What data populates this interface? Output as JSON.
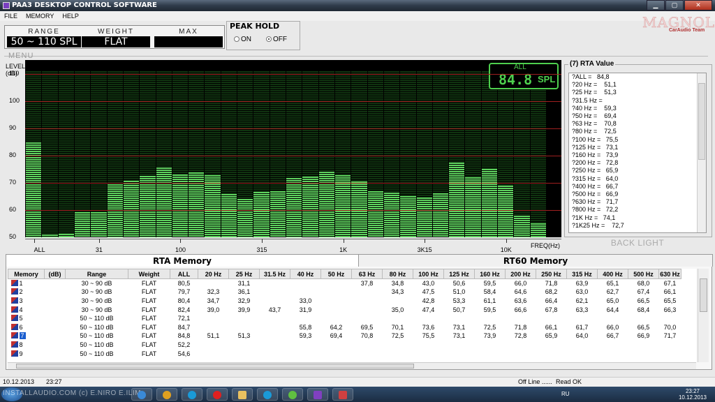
{
  "window": {
    "title": "PAA3 DESKTOP CONTROL SOFTWARE"
  },
  "menu": [
    "FILE",
    "MEMORY",
    "HELP"
  ],
  "logo": {
    "brand": "MAGNOLIA",
    "team": "CarAudio Team"
  },
  "display": {
    "range_label": "RANGE",
    "range_value": "50 ~ 110 SPL",
    "weight_label": "WEIGHT",
    "weight_value": "FLAT",
    "max_label": "MAX",
    "max_value": ""
  },
  "peak_hold": {
    "title": "PEAK HOLD",
    "on": "ON",
    "off": "OFF",
    "selected": "OFF"
  },
  "menu_section_label": "MENU",
  "graph": {
    "level_label": "LEVEL\n(dB)",
    "freq_label": "FREQ(Hz)",
    "all_label": "ALL",
    "spl_value": "84.8",
    "spl_unit": "SPL",
    "colors": {
      "bar": "#5fd45f",
      "bg": "#000000",
      "gridline": "#a02020"
    }
  },
  "chart_data": {
    "type": "bar",
    "ylabel": "LEVEL (dB)",
    "xlabel": "FREQ(Hz)",
    "ylim": [
      50,
      115
    ],
    "y_ticks": [
      50,
      60,
      70,
      80,
      90,
      100,
      110
    ],
    "x_tick_labels": [
      "ALL",
      "31",
      "100",
      "315",
      "1K",
      "3K15",
      "10K"
    ],
    "x_tick_band_index": [
      0,
      4,
      9,
      14,
      19,
      24,
      29
    ],
    "bands": [
      "ALL",
      "20",
      "25",
      "31.5",
      "40",
      "50",
      "63",
      "80",
      "100",
      "125",
      "160",
      "200",
      "250",
      "315",
      "400",
      "500",
      "630",
      "800",
      "1K",
      "1K25",
      "1K6",
      "2K",
      "2K5",
      "3K15",
      "4K",
      "5K",
      "6K3",
      "8K",
      "10K",
      "12K5",
      "16K",
      "20K"
    ],
    "values": [
      84.8,
      51.1,
      51.3,
      59.3,
      59.3,
      69.4,
      70.8,
      72.5,
      75.5,
      73.1,
      73.9,
      72.8,
      65.9,
      64.0,
      66.7,
      66.9,
      71.7,
      72.2,
      74.1,
      72.7,
      70.5,
      67.0,
      66.5,
      65.0,
      64.5,
      66.0,
      77.5,
      72.0,
      75.0,
      69.0,
      58.0,
      55.0
    ]
  },
  "rta_panel": {
    "title": "(7) RTA Value",
    "rows": [
      "?ALL =   84,8",
      "?20 Hz =    51,1",
      "?25 Hz =    51,3",
      "?31.5 Hz =",
      "?40 Hz =    59,3",
      "?50 Hz =    69,4",
      "?63 Hz =    70,8",
      "?80 Hz =    72,5",
      "?100 Hz =   75,5",
      "?125 Hz =   73,1",
      "?160 Hz =   73,9",
      "?200 Hz =   72,8",
      "?250 Hz =   65,9",
      "?315 Hz =   64,0",
      "?400 Hz =   66,7",
      "?500 Hz =   66,9",
      "?630 Hz =   71,7",
      "?800 Hz =   72,2",
      "?1K Hz =   74,1",
      "?1K25 Hz =    72,7"
    ],
    "backlight": "BACK LIGHT"
  },
  "tabs": {
    "rta": "RTA Memory",
    "rt60": "RT60 Memory"
  },
  "table": {
    "headers": [
      "Memory",
      "(dB)",
      "Range",
      "Weight",
      "ALL",
      "20 Hz",
      "25 Hz",
      "31.5 Hz",
      "40 Hz",
      "50 Hz",
      "63 Hz",
      "80 Hz",
      "100 Hz",
      "125 Hz",
      "160 Hz",
      "200 Hz",
      "250 Hz",
      "315 Hz",
      "400 Hz",
      "500 Hz",
      "630 Hz"
    ],
    "rows": [
      [
        "1",
        "",
        "30 ~ 90 dB",
        "FLAT",
        "80,5",
        "",
        "31,1",
        "",
        "",
        "",
        "37,8",
        "34,8",
        "43,0",
        "50,6",
        "59,5",
        "66,0",
        "71,8",
        "63,9",
        "65,1",
        "68,0",
        "67,1"
      ],
      [
        "2",
        "",
        "30 ~ 90 dB",
        "FLAT",
        "79,7",
        "32,3",
        "36,1",
        "",
        "",
        "",
        "",
        "34,3",
        "47,5",
        "51,0",
        "58,4",
        "64,6",
        "68,2",
        "63,0",
        "62,7",
        "67,4",
        "66,1"
      ],
      [
        "3",
        "",
        "30 ~ 90 dB",
        "FLAT",
        "80,4",
        "34,7",
        "32,9",
        "",
        "33,0",
        "",
        "",
        "",
        "42,8",
        "53,3",
        "61,1",
        "63,6",
        "66,4",
        "62,1",
        "65,0",
        "66,5",
        "65,5"
      ],
      [
        "4",
        "",
        "30 ~ 90 dB",
        "FLAT",
        "82,4",
        "39,0",
        "39,9",
        "43,7",
        "31,9",
        "",
        "",
        "35,0",
        "47,4",
        "50,7",
        "59,5",
        "66,6",
        "67,8",
        "63,3",
        "64,4",
        "68,4",
        "66,3"
      ],
      [
        "5",
        "",
        "50 ~ 110 dB",
        "FLAT",
        "72,1",
        "",
        "",
        "",
        "",
        "",
        "",
        "",
        "",
        "",
        "",
        "",
        "",
        "",
        "",
        "",
        ""
      ],
      [
        "6",
        "",
        "50 ~ 110 dB",
        "FLAT",
        "84,7",
        "",
        "",
        "",
        "55,8",
        "64,2",
        "69,5",
        "70,1",
        "73,6",
        "73,1",
        "72,5",
        "71,8",
        "66,1",
        "61,7",
        "66,0",
        "66,5",
        "70,0"
      ],
      [
        "7",
        "",
        "50 ~ 110 dB",
        "FLAT",
        "84,8",
        "51,1",
        "51,3",
        "",
        "59,3",
        "69,4",
        "70,8",
        "72,5",
        "75,5",
        "73,1",
        "73,9",
        "72,8",
        "65,9",
        "64,0",
        "66,7",
        "66,9",
        "71,7"
      ],
      [
        "8",
        "",
        "50 ~ 110 dB",
        "FLAT",
        "52,2",
        "",
        "",
        "",
        "",
        "",
        "",
        "",
        "",
        "",
        "",
        "",
        "",
        "",
        "",
        "",
        ""
      ],
      [
        "9",
        "",
        "50 ~ 110 dB",
        "FLAT",
        "54,6",
        "",
        "",
        "",
        "",
        "",
        "",
        "",
        "",
        "",
        "",
        "",
        "",
        "",
        "",
        "",
        ""
      ]
    ],
    "selected_row": 6
  },
  "status": {
    "date": "10.12.2013",
    "time": "23:27",
    "line": "Off Line ......",
    "read": "Read OK"
  },
  "taskbar": {
    "watermark": "INSTALLAUDIO.COM (c) E.NIRO E.ILIM",
    "lang": "RU",
    "clock_time": "23:27",
    "clock_date": "10.12.2013"
  }
}
